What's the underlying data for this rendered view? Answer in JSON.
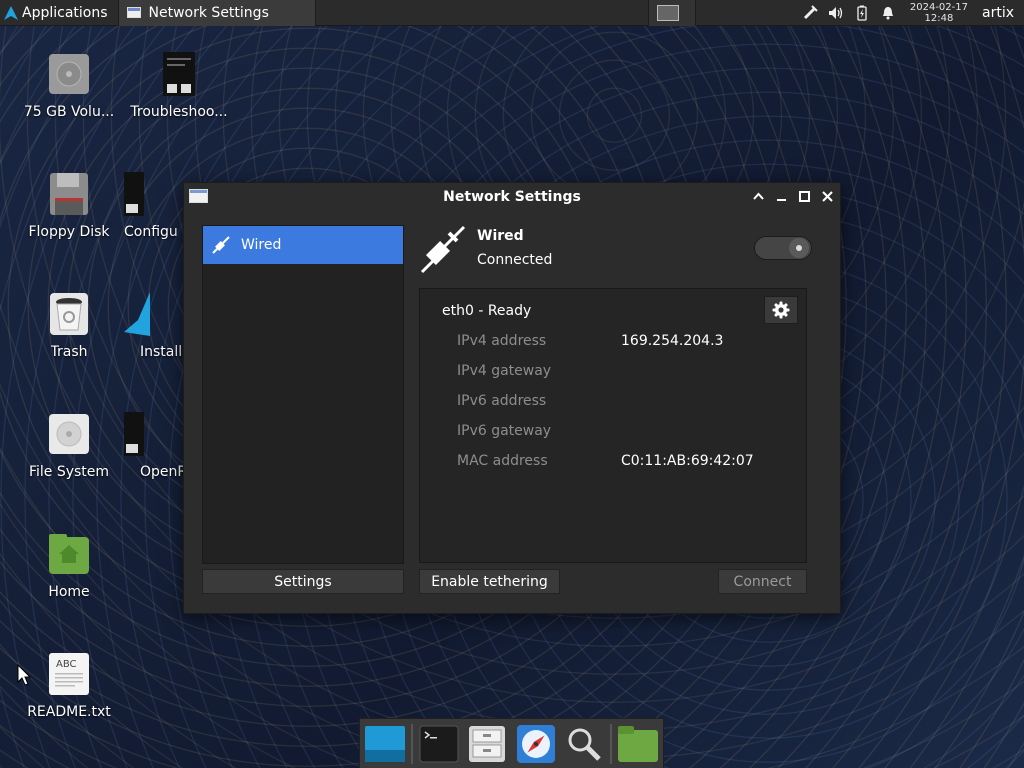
{
  "top_panel": {
    "apps_label": "Applications",
    "task_title": "Network Settings",
    "clock_date": "2024-02-17",
    "clock_time": "12:48",
    "user": "artix"
  },
  "desktop": {
    "icons": [
      {
        "label": "75 GB Volu..."
      },
      {
        "label": "Troubleshoo..."
      },
      {
        "label": "Floppy Disk"
      },
      {
        "label": "Configu"
      },
      {
        "label": "Trash"
      },
      {
        "label": "Install"
      },
      {
        "label": "File System"
      },
      {
        "label": "OpenR"
      },
      {
        "label": "Home"
      },
      {
        "label": "README.txt"
      }
    ]
  },
  "window": {
    "title": "Network Settings",
    "sidebar": {
      "items": [
        {
          "label": "Wired"
        }
      ]
    },
    "buttons": {
      "settings": "Settings",
      "tethering": "Enable tethering",
      "connect": "Connect"
    },
    "connection": {
      "name": "Wired",
      "state": "Connected",
      "enabled": true
    },
    "device": {
      "title": "eth0 - Ready",
      "properties": [
        {
          "key": "IPv4 address",
          "value": "169.254.204.3"
        },
        {
          "key": "IPv4 gateway",
          "value": ""
        },
        {
          "key": "IPv6 address",
          "value": ""
        },
        {
          "key": "IPv6 gateway",
          "value": ""
        },
        {
          "key": "MAC address",
          "value": "C0:11:AB:69:42:07"
        }
      ]
    }
  },
  "icons": {
    "wired": "ethernet-plug-icon",
    "gear": "gear-icon",
    "window": "window-icon"
  },
  "colors": {
    "accent": "#3d7ae0",
    "panel": "#2b2b2b",
    "window_bg": "#2c2c2c"
  }
}
